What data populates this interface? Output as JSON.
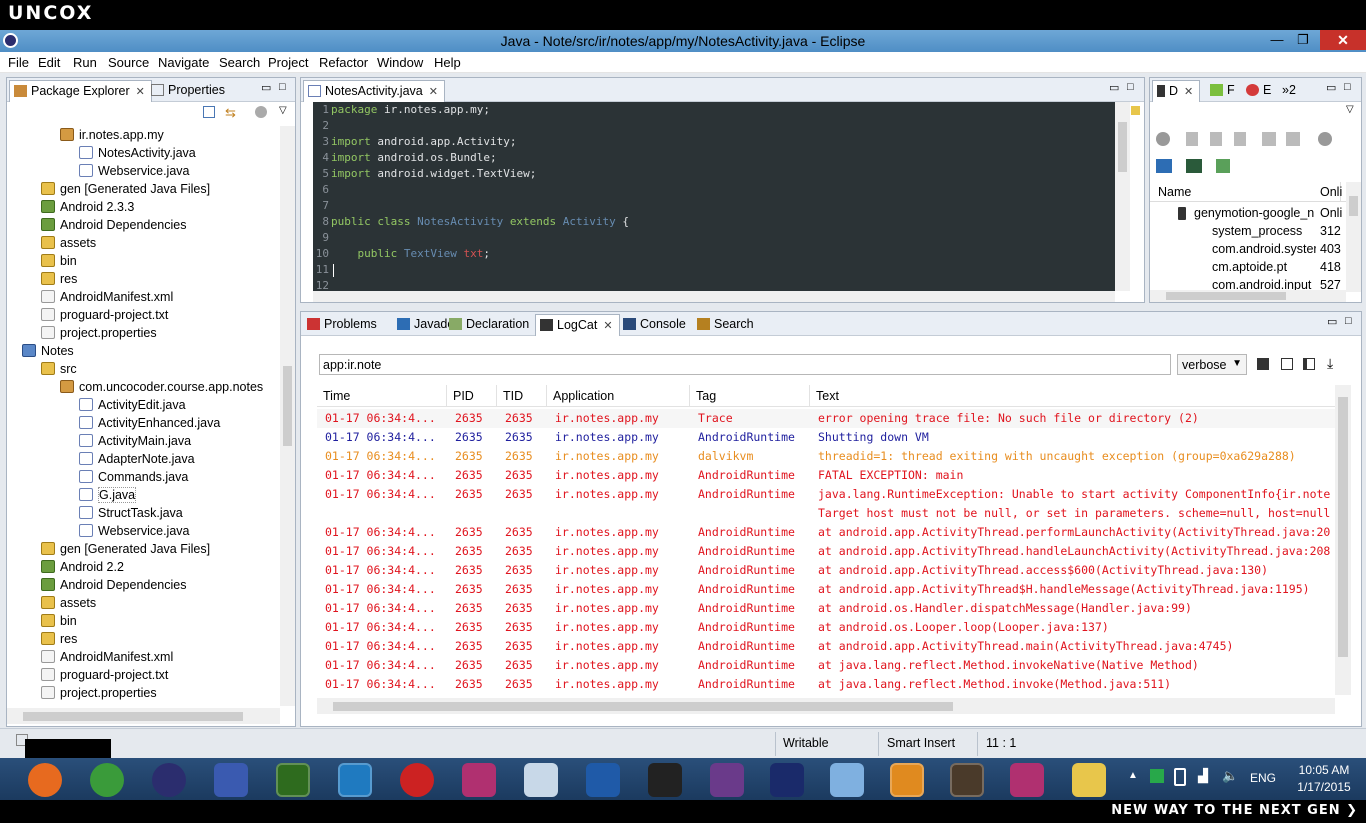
{
  "brand": "uncox",
  "window": {
    "title": "Java - Note/src/ir/notes/app/my/NotesActivity.java - Eclipse",
    "minimize": "—",
    "restore": "❐",
    "close": "✕"
  },
  "menu": [
    "File",
    "Edit",
    "Run",
    "Source",
    "Navigate",
    "Search",
    "Project",
    "Refactor",
    "Window",
    "Help"
  ],
  "package_explorer": {
    "tabs": [
      "Package Explorer",
      "Properties"
    ],
    "tree": [
      {
        "label": "ir.notes.app.my",
        "indent": 3,
        "icon": "pkg"
      },
      {
        "label": "NotesActivity.java",
        "indent": 4,
        "icon": "java"
      },
      {
        "label": "Webservice.java",
        "indent": 4,
        "icon": "java"
      },
      {
        "label": "gen [Generated Java Files]",
        "indent": 2,
        "icon": "folder"
      },
      {
        "label": "Android 2.3.3",
        "indent": 2,
        "icon": "lib"
      },
      {
        "label": "Android Dependencies",
        "indent": 2,
        "icon": "lib"
      },
      {
        "label": "assets",
        "indent": 2,
        "icon": "folder"
      },
      {
        "label": "bin",
        "indent": 2,
        "icon": "folder"
      },
      {
        "label": "res",
        "indent": 2,
        "icon": "folder"
      },
      {
        "label": "AndroidManifest.xml",
        "indent": 2,
        "icon": "file"
      },
      {
        "label": "proguard-project.txt",
        "indent": 2,
        "icon": "file"
      },
      {
        "label": "project.properties",
        "indent": 2,
        "icon": "file"
      },
      {
        "label": "Notes",
        "indent": 1,
        "icon": "proj"
      },
      {
        "label": "src",
        "indent": 2,
        "icon": "folder"
      },
      {
        "label": "com.uncocoder.course.app.notes",
        "indent": 3,
        "icon": "pkg"
      },
      {
        "label": "ActivityEdit.java",
        "indent": 4,
        "icon": "java"
      },
      {
        "label": "ActivityEnhanced.java",
        "indent": 4,
        "icon": "java"
      },
      {
        "label": "ActivityMain.java",
        "indent": 4,
        "icon": "java"
      },
      {
        "label": "AdapterNote.java",
        "indent": 4,
        "icon": "java"
      },
      {
        "label": "Commands.java",
        "indent": 4,
        "icon": "java"
      },
      {
        "label": "G.java",
        "indent": 4,
        "icon": "java"
      },
      {
        "label": "StructTask.java",
        "indent": 4,
        "icon": "java"
      },
      {
        "label": "Webservice.java",
        "indent": 4,
        "icon": "java"
      },
      {
        "label": "gen [Generated Java Files]",
        "indent": 2,
        "icon": "folder"
      },
      {
        "label": "Android 2.2",
        "indent": 2,
        "icon": "lib"
      },
      {
        "label": "Android Dependencies",
        "indent": 2,
        "icon": "lib"
      },
      {
        "label": "assets",
        "indent": 2,
        "icon": "folder"
      },
      {
        "label": "bin",
        "indent": 2,
        "icon": "folder"
      },
      {
        "label": "res",
        "indent": 2,
        "icon": "folder"
      },
      {
        "label": "AndroidManifest.xml",
        "indent": 2,
        "icon": "file"
      },
      {
        "label": "proguard-project.txt",
        "indent": 2,
        "icon": "file"
      },
      {
        "label": "project.properties",
        "indent": 2,
        "icon": "file"
      }
    ]
  },
  "editor": {
    "tab": "NotesActivity.java",
    "line_numbers": [
      "1",
      "2",
      "3",
      "4",
      "5",
      "6",
      "7",
      "8",
      "9",
      "10",
      "11",
      "12"
    ],
    "lines": [
      [
        [
          "kw",
          "package"
        ],
        [
          "t",
          " ir.notes.app.my;"
        ]
      ],
      [],
      [
        [
          "kw",
          "import"
        ],
        [
          "t",
          " android.app.Activity;"
        ]
      ],
      [
        [
          "kw",
          "import"
        ],
        [
          "t",
          " android.os.Bundle;"
        ]
      ],
      [
        [
          "kw",
          "import"
        ],
        [
          "t",
          " android.widget.TextView;"
        ]
      ],
      [],
      [],
      [
        [
          "kw",
          "public class "
        ],
        [
          "cls",
          "NotesActivity "
        ],
        [
          "kw",
          "extends "
        ],
        [
          "cls",
          "Activity"
        ],
        [
          "t",
          " {"
        ]
      ],
      [],
      [
        [
          "t",
          "    "
        ],
        [
          "kw",
          "public "
        ],
        [
          "cls",
          "TextView "
        ],
        [
          "fld",
          "txt"
        ],
        [
          "t",
          ";"
        ]
      ],
      [],
      []
    ]
  },
  "devices": {
    "tabs": [
      "D",
      "F",
      "E",
      "»2"
    ],
    "columns": [
      "Name",
      "Onli"
    ],
    "rows": [
      {
        "name": "genymotion-google_n",
        "val": "Onli",
        "indent": 1
      },
      {
        "name": "system_process",
        "val": "312",
        "indent": 2
      },
      {
        "name": "com.android.syster",
        "val": "403",
        "indent": 2
      },
      {
        "name": "cm.aptoide.pt",
        "val": "418",
        "indent": 2
      },
      {
        "name": "com.android.input",
        "val": "527",
        "indent": 2
      }
    ]
  },
  "bottom_tabs": [
    "Problems",
    "Javadoc",
    "Declaration",
    "LogCat",
    "Console",
    "Search"
  ],
  "logcat": {
    "filter_value": "app:ir.note",
    "level": "verbose",
    "columns": [
      "Time",
      "PID",
      "TID",
      "Application",
      "Tag",
      "Text"
    ],
    "colors": {
      "error": "#e0141e",
      "info": "#1f1f9e",
      "warn": "#e88d1f"
    },
    "rows": [
      {
        "level": "error",
        "time": "01-17 06:34:4...",
        "pid": "2635",
        "tid": "2635",
        "app": "ir.notes.app.my",
        "tag": "Trace",
        "text": "error opening trace file: No such file or directory (2)"
      },
      {
        "level": "info",
        "time": "01-17 06:34:4...",
        "pid": "2635",
        "tid": "2635",
        "app": "ir.notes.app.my",
        "tag": "AndroidRuntime",
        "text": "Shutting down VM"
      },
      {
        "level": "warn",
        "time": "01-17 06:34:4...",
        "pid": "2635",
        "tid": "2635",
        "app": "ir.notes.app.my",
        "tag": "dalvikvm",
        "text": "threadid=1: thread exiting with uncaught exception (group=0xa629a288)"
      },
      {
        "level": "error",
        "time": "01-17 06:34:4...",
        "pid": "2635",
        "tid": "2635",
        "app": "ir.notes.app.my",
        "tag": "AndroidRuntime",
        "text": "FATAL EXCEPTION: main"
      },
      {
        "level": "error",
        "time": "01-17 06:34:4...",
        "pid": "2635",
        "tid": "2635",
        "app": "ir.notes.app.my",
        "tag": "AndroidRuntime",
        "text": "java.lang.RuntimeException: Unable to start activity ComponentInfo{ir.note"
      },
      {
        "level": "error",
        "time": "",
        "pid": "",
        "tid": "",
        "app": "",
        "tag": "",
        "text": "Target host must not be null, or set in parameters. scheme=null, host=null"
      },
      {
        "level": "error",
        "time": "01-17 06:34:4...",
        "pid": "2635",
        "tid": "2635",
        "app": "ir.notes.app.my",
        "tag": "AndroidRuntime",
        "text": "at android.app.ActivityThread.performLaunchActivity(ActivityThread.java:20"
      },
      {
        "level": "error",
        "time": "01-17 06:34:4...",
        "pid": "2635",
        "tid": "2635",
        "app": "ir.notes.app.my",
        "tag": "AndroidRuntime",
        "text": "at android.app.ActivityThread.handleLaunchActivity(ActivityThread.java:208"
      },
      {
        "level": "error",
        "time": "01-17 06:34:4...",
        "pid": "2635",
        "tid": "2635",
        "app": "ir.notes.app.my",
        "tag": "AndroidRuntime",
        "text": "at android.app.ActivityThread.access$600(ActivityThread.java:130)"
      },
      {
        "level": "error",
        "time": "01-17 06:34:4...",
        "pid": "2635",
        "tid": "2635",
        "app": "ir.notes.app.my",
        "tag": "AndroidRuntime",
        "text": "at android.app.ActivityThread$H.handleMessage(ActivityThread.java:1195)"
      },
      {
        "level": "error",
        "time": "01-17 06:34:4...",
        "pid": "2635",
        "tid": "2635",
        "app": "ir.notes.app.my",
        "tag": "AndroidRuntime",
        "text": "at android.os.Handler.dispatchMessage(Handler.java:99)"
      },
      {
        "level": "error",
        "time": "01-17 06:34:4...",
        "pid": "2635",
        "tid": "2635",
        "app": "ir.notes.app.my",
        "tag": "AndroidRuntime",
        "text": "at android.os.Looper.loop(Looper.java:137)"
      },
      {
        "level": "error",
        "time": "01-17 06:34:4...",
        "pid": "2635",
        "tid": "2635",
        "app": "ir.notes.app.my",
        "tag": "AndroidRuntime",
        "text": "at android.app.ActivityThread.main(ActivityThread.java:4745)"
      },
      {
        "level": "error",
        "time": "01-17 06:34:4...",
        "pid": "2635",
        "tid": "2635",
        "app": "ir.notes.app.my",
        "tag": "AndroidRuntime",
        "text": "at java.lang.reflect.Method.invokeNative(Native Method)"
      },
      {
        "level": "error",
        "time": "01-17 06:34:4...",
        "pid": "2635",
        "tid": "2635",
        "app": "ir.notes.app.my",
        "tag": "AndroidRuntime",
        "text": "at java.lang.reflect.Method.invoke(Method.java:511)"
      }
    ]
  },
  "status": {
    "writable": "Writable",
    "insert_mode": "Smart Insert",
    "position": "11 : 1"
  },
  "taskbar": {
    "apps": [
      "firefox",
      "chrome",
      "eclipse",
      "vs",
      "dreamweaver",
      "jetbrains",
      "nero",
      "flickr",
      "picasa",
      "word",
      "unity",
      "spider",
      "photoshop",
      "virtualbox",
      "media",
      "javaee",
      "flickr2",
      "explorer"
    ],
    "lang": "ENG",
    "time": "10:05 AM",
    "date": "1/17/2015"
  },
  "slogan": "NEW WAY TO THE NEXT GEN ❯"
}
